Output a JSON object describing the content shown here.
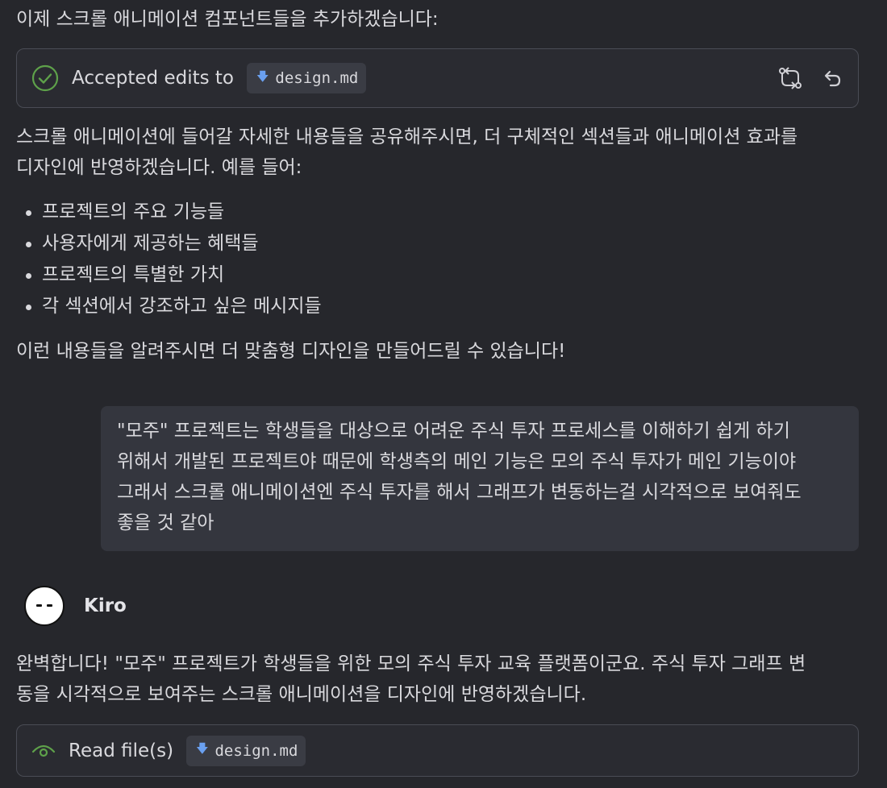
{
  "intro_text": "이제 스크롤 애니메이션 컴포넌트들을 추가하겠습니다:",
  "accepted_card": {
    "status_text": "Accepted edits to",
    "file_name": "design.md",
    "status_color": "#5ea14a",
    "icons": [
      "check-circle-icon",
      "compare-icon",
      "undo-icon"
    ]
  },
  "message_paragraph_1": "스크롤 애니메이션에 들어갈 자세한 내용들을 공유해주시면, 더 구체적인 섹션들과 애니메이션 효과를",
  "message_paragraph_1b": "디자인에 반영하겠습니다. 예를 들어:",
  "bullets": [
    "프로젝트의 주요 기능들",
    "사용자에게 제공하는 혜택들",
    "프로젝트의 특별한 가치",
    "각 섹션에서 강조하고 싶은 메시지들"
  ],
  "message_paragraph_2": "이런 내용들을 알려주시면 더 맞춤형 디자인을 만들어드릴 수 있습니다!",
  "user_message": {
    "lines": [
      "\"모주\" 프로젝트는 학생들을 대상으로 어려운 주식 투자 프로세스를 이해하기 쉽게 하기",
      "위해서 개발된 프로젝트야 때문에 학생측의 메인 기능은 모의 주식 투자가 메인 기능이야",
      "그래서 스크롤 애니메이션엔 주식 투자를 해서 그래프가 변동하는걸 시각적으로 보여줘도",
      "좋을 것 같아"
    ]
  },
  "agent": {
    "name": "Kiro"
  },
  "agent_reply": {
    "line1": "완벽합니다! \"모주\" 프로젝트가 학생들을 위한 모의 주식 투자 교육 플랫폼이군요. 주식 투자 그래프 변",
    "line2": "동을 시각적으로 보여주는 스크롤 애니메이션을 디자인에 반영하겠습니다."
  },
  "read_card": {
    "status_text": "Read file(s)",
    "file_name": "design.md",
    "icon": "eye-icon",
    "icon_color": "#5ea14a"
  }
}
